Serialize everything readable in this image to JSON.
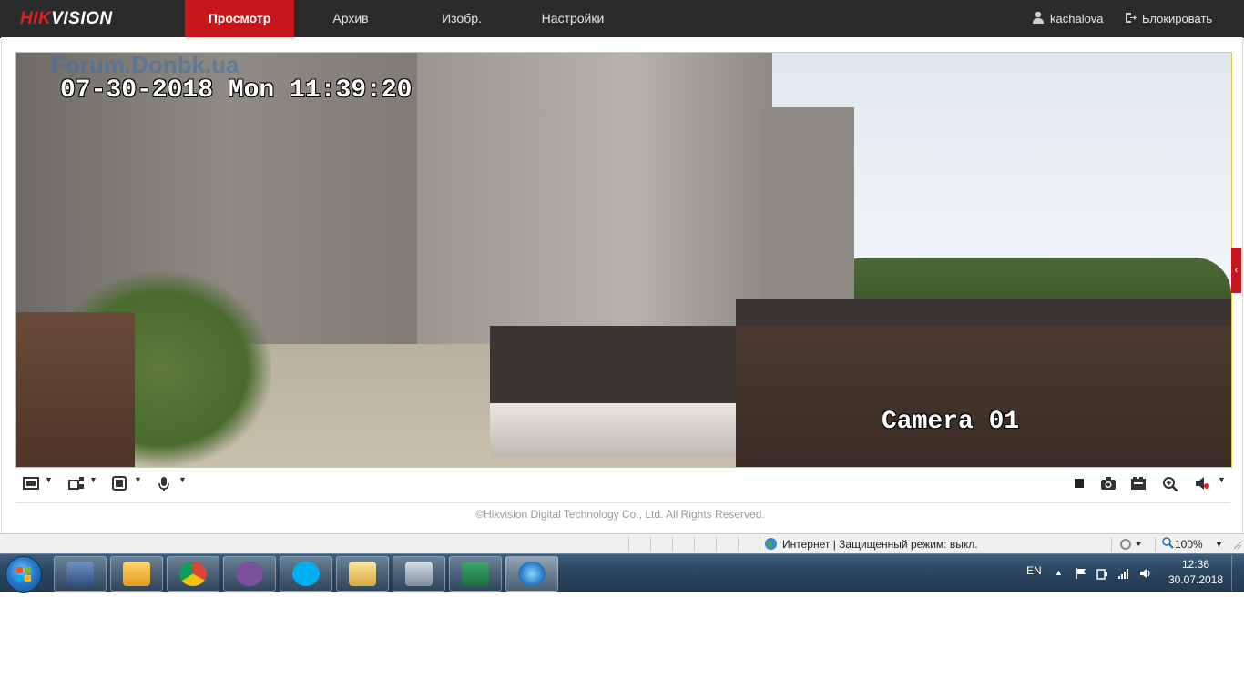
{
  "brand": {
    "hik": "HIK",
    "vision": "VISION"
  },
  "nav": {
    "items": [
      "Просмотр",
      "Архив",
      "Изобр.",
      "Настройки"
    ],
    "user": "kachalova",
    "lock": "Блокировать"
  },
  "video": {
    "timestamp": "07-30-2018 Mon 11:39:20",
    "camera_label": "Camera 01",
    "watermark": "Forum.Donbk.ua"
  },
  "toolbar": {
    "left_icons": [
      "window-layout-icon",
      "stream-select-icon",
      "aspect-ratio-icon",
      "microphone-icon"
    ],
    "right_icons": [
      "stop-icon",
      "capture-icon",
      "record-icon",
      "digital-zoom-icon",
      "volume-icon"
    ]
  },
  "footer": {
    "copyright": "©Hikvision Digital Technology Co., Ltd. All Rights Reserved."
  },
  "ie_status": {
    "zone": "Интернет | Защищенный режим: выкл.",
    "zoom": "100%"
  },
  "taskbar": {
    "apps": [
      "network-app",
      "outlook",
      "chrome",
      "viber",
      "skype",
      "explorer",
      "control-panel",
      "excel",
      "internet-explorer"
    ],
    "lang": "EN",
    "time": "12:36",
    "date": "30.07.2018"
  },
  "colors": {
    "accent": "#c8161d",
    "nav_bg": "#2b2b2b",
    "video_border": "#e8c84a"
  }
}
